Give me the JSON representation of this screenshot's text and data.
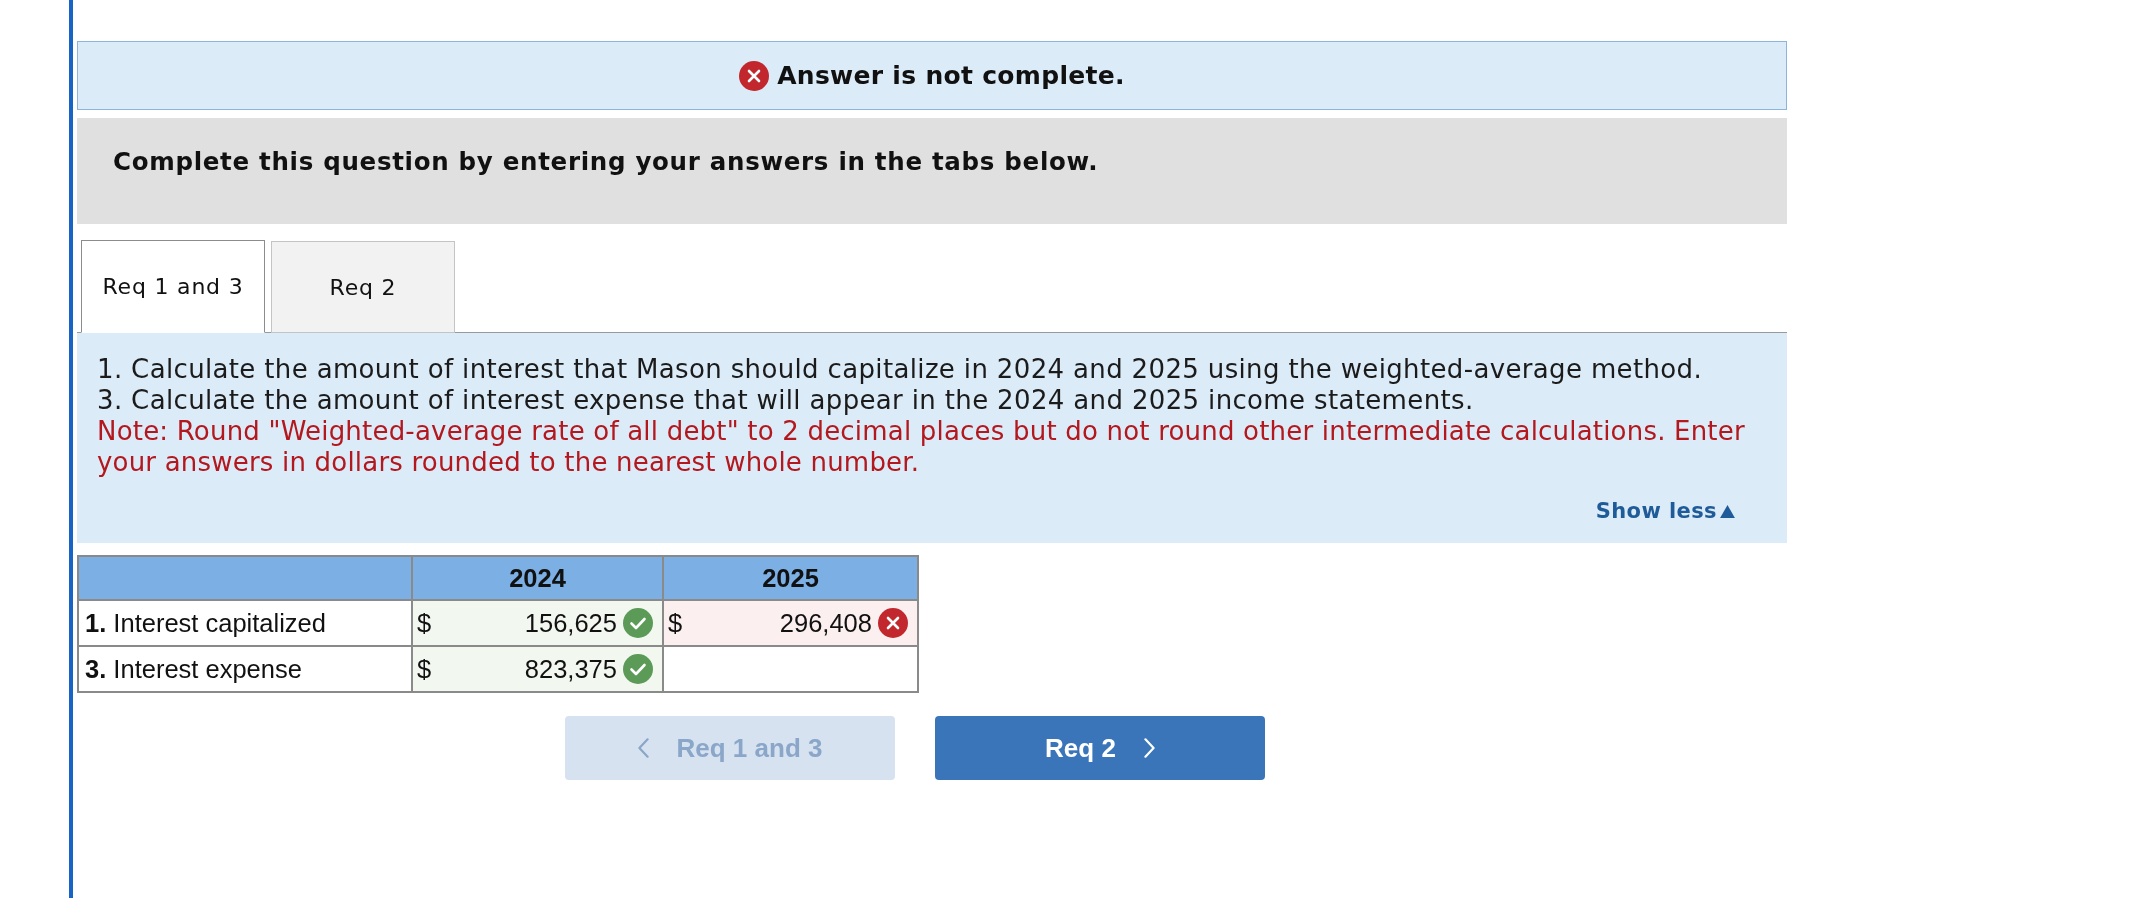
{
  "banner": {
    "complete": false,
    "text": "Answer is not complete."
  },
  "prompt": "Complete this question by entering your answers in the tabs below.",
  "tabs": [
    {
      "label": "Req 1 and 3",
      "selected": true
    },
    {
      "label": "Req 2",
      "selected": false
    }
  ],
  "instructions": {
    "lines": [
      "1. Calculate the amount of interest that Mason should capitalize in 2024 and 2025 using the weighted-average method.",
      "3. Calculate the amount of interest expense that will appear in the 2024 and 2025 income statements."
    ],
    "note": "Note: Round \"Weighted-average rate of all debt\" to 2 decimal places but do not round other intermediate calculations. Enter your answers in dollars rounded to the nearest whole number.",
    "toggle": {
      "label": "Show less",
      "expanded": true
    }
  },
  "table": {
    "columns": [
      "2024",
      "2025"
    ],
    "rows": [
      {
        "label": "**1.** Interest capitalized",
        "cells": [
          {
            "currency": "$",
            "value": "156,625",
            "correct": true
          },
          {
            "currency": "$",
            "value": "296,408",
            "correct": false
          }
        ]
      },
      {
        "label": "**3.** Interest expense",
        "cells": [
          {
            "currency": "$",
            "value": "823,375",
            "correct": true
          }
        ]
      }
    ]
  },
  "nav": [
    {
      "kind": "prev",
      "label": "Req 1 and 3",
      "disabled": true
    },
    {
      "kind": "next",
      "label": "Req 2",
      "disabled": false
    }
  ]
}
